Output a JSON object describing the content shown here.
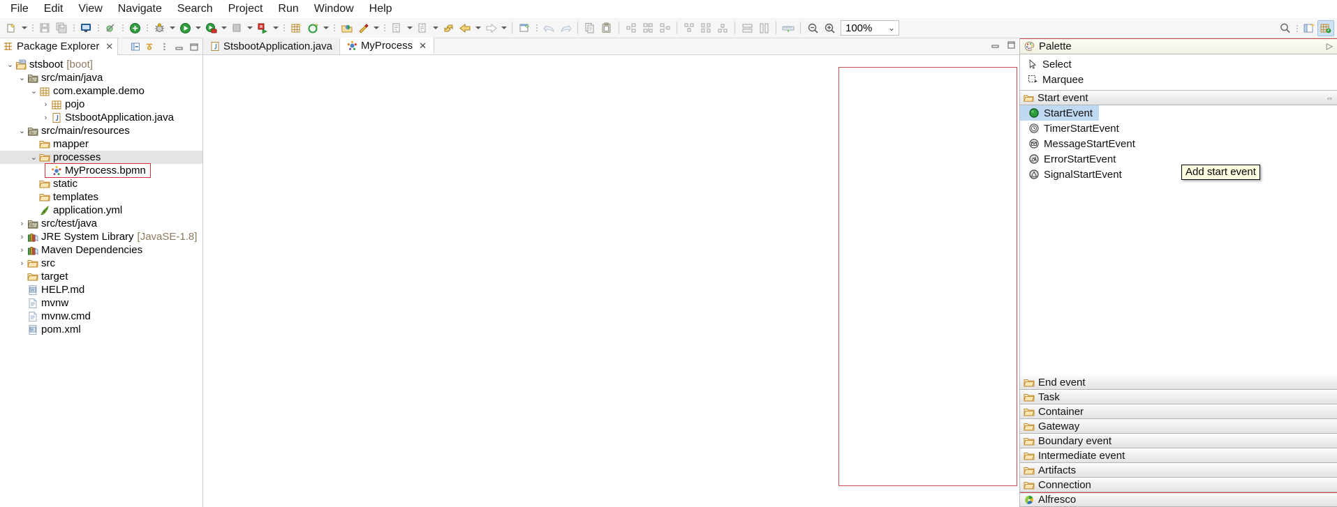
{
  "menu": {
    "items": [
      "File",
      "Edit",
      "View",
      "Navigate",
      "Search",
      "Project",
      "Run",
      "Window",
      "Help"
    ]
  },
  "toolbar": {
    "zoom_value": "100%",
    "zoom_in_title": "Zoom In",
    "zoom_out_title": "Zoom Out",
    "icons": [
      "new-wizard-icon",
      "save-icon",
      "save-all-icon",
      "console-icon",
      "skip-breakpoints-icon",
      "boot-dashboard-icon",
      "debug-icon",
      "run-icon",
      "run-coverage-icon",
      "terminate-icon",
      "new-java-class-icon",
      "new-package-icon",
      "open-type-icon",
      "external-tools-icon",
      "search-icon",
      "next-annotation-icon",
      "previous-annotation-icon",
      "last-edit-icon",
      "back-icon",
      "forward-icon",
      "pin-editor-icon",
      "undo-icon",
      "redo-icon",
      "copy-icon",
      "paste-icon",
      "align-left-icon",
      "align-center-icon",
      "align-right-icon",
      "align-top-icon",
      "align-middle-icon",
      "align-bottom-icon",
      "match-width-icon",
      "match-height-icon",
      "ruler-icon",
      "zoom-out-icon",
      "zoom-in-icon"
    ],
    "right_icons": [
      "search-icon",
      "open-perspective-icon",
      "java-perspective-icon"
    ]
  },
  "package_explorer": {
    "title": "Package Explorer",
    "tools": [
      "collapse-all-icon",
      "link-with-editor-icon",
      "view-menu-icon",
      "minimize-icon",
      "maximize-icon"
    ],
    "tree": [
      {
        "indent": 0,
        "arrow": "down",
        "icon": "spring-project-icon",
        "label": "stsboot",
        "suffix": "[boot]"
      },
      {
        "indent": 1,
        "arrow": "down",
        "icon": "source-folder-icon",
        "label": "src/main/java",
        "suffix": ""
      },
      {
        "indent": 2,
        "arrow": "down",
        "icon": "package-icon",
        "label": "com.example.demo",
        "suffix": ""
      },
      {
        "indent": 3,
        "arrow": "right",
        "icon": "package-icon",
        "label": "pojo",
        "suffix": ""
      },
      {
        "indent": 3,
        "arrow": "right",
        "icon": "java-file-icon",
        "label": "StsbootApplication.java",
        "suffix": ""
      },
      {
        "indent": 1,
        "arrow": "down",
        "icon": "source-folder-icon",
        "label": "src/main/resources",
        "suffix": ""
      },
      {
        "indent": 2,
        "arrow": "none",
        "icon": "folder-icon",
        "label": "mapper",
        "suffix": ""
      },
      {
        "indent": 2,
        "arrow": "down",
        "icon": "folder-icon",
        "label": "processes",
        "suffix": "",
        "selected": true
      },
      {
        "indent": 3,
        "arrow": "none",
        "icon": "bpmn-file-icon",
        "label": "MyProcess.bpmn",
        "suffix": "",
        "highlighted": true
      },
      {
        "indent": 2,
        "arrow": "none",
        "icon": "folder-icon",
        "label": "static",
        "suffix": ""
      },
      {
        "indent": 2,
        "arrow": "none",
        "icon": "folder-icon",
        "label": "templates",
        "suffix": ""
      },
      {
        "indent": 2,
        "arrow": "none",
        "icon": "yml-file-icon",
        "label": "application.yml",
        "suffix": ""
      },
      {
        "indent": 1,
        "arrow": "right",
        "icon": "source-folder-icon",
        "label": "src/test/java",
        "suffix": ""
      },
      {
        "indent": 1,
        "arrow": "right",
        "icon": "library-icon",
        "label": "JRE System Library",
        "suffix": "[JavaSE-1.8]"
      },
      {
        "indent": 1,
        "arrow": "right",
        "icon": "library-icon",
        "label": "Maven Dependencies",
        "suffix": ""
      },
      {
        "indent": 1,
        "arrow": "right",
        "icon": "folder-icon",
        "label": "src",
        "suffix": ""
      },
      {
        "indent": 1,
        "arrow": "none",
        "icon": "folder-icon",
        "label": "target",
        "suffix": ""
      },
      {
        "indent": 1,
        "arrow": "none",
        "icon": "markdown-file-icon",
        "label": "HELP.md",
        "suffix": ""
      },
      {
        "indent": 1,
        "arrow": "none",
        "icon": "text-file-icon",
        "label": "mvnw",
        "suffix": ""
      },
      {
        "indent": 1,
        "arrow": "none",
        "icon": "text-file-icon",
        "label": "mvnw.cmd",
        "suffix": ""
      },
      {
        "indent": 1,
        "arrow": "none",
        "icon": "maven-file-icon",
        "label": "pom.xml",
        "suffix": ""
      }
    ]
  },
  "editor": {
    "tabs": [
      {
        "label": "StsbootApplication.java",
        "icon": "java-file-icon",
        "active": false,
        "closable": false
      },
      {
        "label": "MyProcess",
        "icon": "bpmn-file-icon",
        "active": true,
        "closable": true
      }
    ],
    "minimize_icon": "minimize-icon",
    "maximize_icon": "maximize-icon"
  },
  "palette": {
    "title": "Palette",
    "pin_glyph": "▷",
    "tools": [
      {
        "label": "Select",
        "icon": "cursor-arrow-icon"
      },
      {
        "label": "Marquee",
        "icon": "marquee-icon"
      }
    ],
    "open_drawer": {
      "label": "Start event",
      "icon": "folder-icon",
      "entries": [
        {
          "label": "StartEvent",
          "icon": "start-event-icon",
          "selected": true
        },
        {
          "label": "TimerStartEvent",
          "icon": "timer-start-event-icon",
          "selected": false
        },
        {
          "label": "MessageStartEvent",
          "icon": "message-start-event-icon",
          "selected": false
        },
        {
          "label": "ErrorStartEvent",
          "icon": "error-start-event-icon",
          "selected": false
        },
        {
          "label": "SignalStartEvent",
          "icon": "signal-start-event-icon",
          "selected": false
        }
      ]
    },
    "drawers": [
      {
        "label": "End event",
        "icon": "folder-icon"
      },
      {
        "label": "Task",
        "icon": "folder-icon"
      },
      {
        "label": "Container",
        "icon": "folder-icon"
      },
      {
        "label": "Gateway",
        "icon": "folder-icon"
      },
      {
        "label": "Boundary event",
        "icon": "folder-icon"
      },
      {
        "label": "Intermediate event",
        "icon": "folder-icon"
      },
      {
        "label": "Artifacts",
        "icon": "folder-icon"
      },
      {
        "label": "Connection",
        "icon": "folder-icon"
      },
      {
        "label": "Alfresco",
        "icon": "alfresco-icon"
      }
    ]
  },
  "tooltip": {
    "text": "Add start event"
  },
  "colors": {
    "selection_blue": "#bfd9f2",
    "highlight_red": "#cb4a4f",
    "tooltip_bg": "#ffffe1",
    "tree_select_grey": "#e4e4e4"
  }
}
